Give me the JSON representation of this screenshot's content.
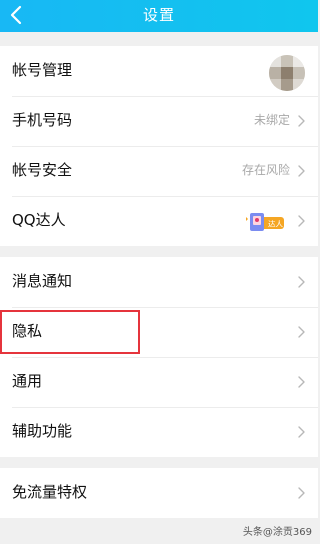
{
  "header": {
    "title": "设置"
  },
  "account_group": [
    {
      "label": "帐号管理",
      "value": ""
    },
    {
      "label": "手机号码",
      "value": "未绑定"
    },
    {
      "label": "帐号安全",
      "value": "存在风险"
    },
    {
      "label": "QQ达人",
      "value": ""
    }
  ],
  "badge": {
    "text": "达人"
  },
  "general_group": [
    {
      "label": "消息通知"
    },
    {
      "label": "隐私"
    },
    {
      "label": "通用"
    },
    {
      "label": "辅助功能"
    }
  ],
  "traffic_group": [
    {
      "label": "免流量特权"
    }
  ],
  "watermark": "头条@涂贡369",
  "colors": {
    "header": "#14bff0",
    "highlight": "#e5343c",
    "background": "#f0f0f0"
  }
}
